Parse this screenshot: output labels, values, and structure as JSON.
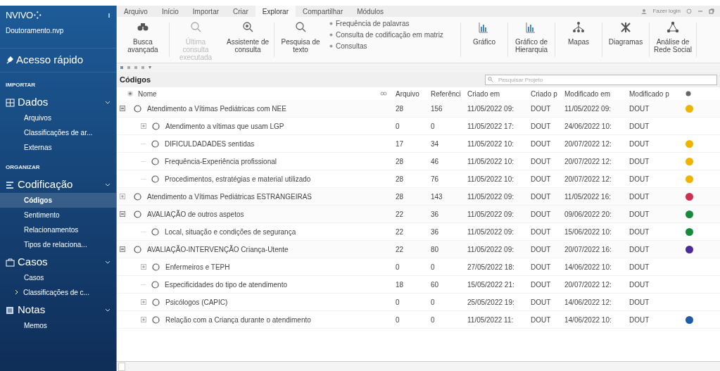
{
  "sidebar": {
    "logo": "NVIVO",
    "logo_mark": "⁘",
    "project": "Doutoramento.nvp",
    "quick_access": "Acesso rápido",
    "sections": [
      {
        "heading": "IMPORTAR",
        "groups": [
          {
            "kind": "grid",
            "label": "Dados",
            "expanded": true,
            "items": [
              {
                "label": "Arquivos",
                "selected": false
              },
              {
                "label": "Classificações de ar...",
                "selected": false
              },
              {
                "label": "Externas",
                "selected": false
              }
            ]
          }
        ]
      },
      {
        "heading": "ORGANIZAR",
        "groups": [
          {
            "kind": "lines",
            "label": "Codificação",
            "expanded": true,
            "items": [
              {
                "label": "Códigos",
                "selected": true
              },
              {
                "label": "Sentimento",
                "selected": false
              },
              {
                "label": "Relacionamentos",
                "selected": false
              },
              {
                "label": "Tipos de relaciona...",
                "selected": false
              }
            ]
          },
          {
            "kind": "case",
            "label": "Casos",
            "expanded": true,
            "items": [
              {
                "label": "Casos",
                "selected": false
              },
              {
                "label": "Classificações de c...",
                "selected": false,
                "expandable": true
              }
            ]
          },
          {
            "kind": "notes",
            "label": "Notas",
            "expanded": true,
            "items": [
              {
                "label": "Memos",
                "selected": false
              }
            ]
          }
        ]
      }
    ]
  },
  "tabs": [
    {
      "label": "Arquivo",
      "selected": false
    },
    {
      "label": "Início",
      "selected": false
    },
    {
      "label": "Importar",
      "selected": false
    },
    {
      "label": "Criar",
      "selected": false
    },
    {
      "label": "Explorar",
      "selected": true
    },
    {
      "label": "Compartilhar",
      "selected": false
    },
    {
      "label": "Módulos",
      "selected": false
    }
  ],
  "login": "Fazer login",
  "ribbon": {
    "large_left": [
      {
        "kind": "binoculars",
        "label": "Busca avançada",
        "disabled": false
      },
      {
        "kind": "query",
        "label": "Última consulta executada",
        "disabled": true
      },
      {
        "kind": "wizard",
        "label": "Assistente de consulta",
        "disabled": false
      },
      {
        "kind": "search",
        "label": "Pesquisa de texto",
        "disabled": false
      }
    ],
    "small": [
      "Frequência de palavras",
      "Consulta de codificação em matriz",
      "Consultas"
    ],
    "large_right": [
      {
        "kind": "chart",
        "label": "Gráfico"
      },
      {
        "kind": "chart",
        "label": "Gráfico de Hierarquia"
      },
      {
        "kind": "map",
        "label": "Mapas"
      },
      {
        "kind": "diagram",
        "label": "Diagramas"
      },
      {
        "kind": "network",
        "label": "Análise de Rede Social"
      }
    ]
  },
  "panel": {
    "title": "Códigos",
    "search": {
      "placeholder": "Pesquisar Projeto"
    }
  },
  "table": {
    "columns": [
      "Nome",
      "Arquivo",
      "Referênci",
      "Criado em",
      "Criado p",
      "Modificado em",
      "Modificado p"
    ],
    "rows": [
      {
        "name": "Atendimento a Vítimas Pediátricas com NEE",
        "files": "28",
        "refs": "156",
        "created": "11/05/2022 09:",
        "created_by": "DOUT",
        "modified": "11/05/2022 09:",
        "modified_by": "DOUT",
        "color": "#f0b400",
        "expanded": true,
        "children": [
          {
            "name": "Atendimento a vítimas que usam LGP",
            "files": "0",
            "refs": "0",
            "created": "11/05/2022 17:",
            "created_by": "DOUT",
            "modified": "24/06/2022 10:",
            "modified_by": "DOUT",
            "expanded": false
          },
          {
            "name": "DIFICULDADADES sentidas",
            "files": "17",
            "refs": "34",
            "created": "11/05/2022 10:",
            "created_by": "DOUT",
            "modified": "20/07/2022 12:",
            "modified_by": "DOUT",
            "color": "#f0b400"
          },
          {
            "name": "Frequência-Experiência profissional",
            "files": "28",
            "refs": "46",
            "created": "11/05/2022 10:",
            "created_by": "DOUT",
            "modified": "20/07/2022 12:",
            "modified_by": "DOUT",
            "color": "#f0b400"
          },
          {
            "name": "Procedimentos, estratégias e material utilizado",
            "files": "28",
            "refs": "76",
            "created": "11/05/2022 10:",
            "created_by": "DOUT",
            "modified": "20/07/2022 12:",
            "modified_by": "DOUT",
            "color": "#f0b400"
          }
        ]
      },
      {
        "name": "Atendimento a Vítimas Pediátricas ESTRANGEIRAS",
        "files": "28",
        "refs": "143",
        "created": "11/05/2022 09:",
        "created_by": "DOUT",
        "modified": "11/05/2022 16:",
        "modified_by": "DOUT",
        "color": "#d0304f",
        "expanded": false
      },
      {
        "name": "AVALIAÇÃO de outros aspetos",
        "files": "22",
        "refs": "36",
        "created": "11/05/2022 09:",
        "created_by": "DOUT",
        "modified": "09/06/2022 20:",
        "modified_by": "DOUT",
        "color": "#178a3c",
        "expanded": true,
        "children": [
          {
            "name": "Local, situação e condições de segurança",
            "files": "22",
            "refs": "36",
            "created": "11/05/2022 09:",
            "created_by": "DOUT",
            "modified": "15/06/2022 10:",
            "modified_by": "DOUT",
            "color": "#178a3c"
          }
        ]
      },
      {
        "name": "AVALIAÇÃO-INTERVENÇÃO Criança-Utente",
        "files": "22",
        "refs": "80",
        "created": "11/05/2022 09:",
        "created_by": "DOUT",
        "modified": "20/07/2022 16:",
        "modified_by": "DOUT",
        "color": "#4b2a9c",
        "expanded": true,
        "children": [
          {
            "name": "Enfermeiros e TEPH",
            "files": "0",
            "refs": "0",
            "created": "27/05/2022 18:",
            "created_by": "DOUT",
            "modified": "14/06/2022 10:",
            "modified_by": "DOUT",
            "expanded": false
          },
          {
            "name": "Especificidades do tipo de atendimento",
            "files": "18",
            "refs": "60",
            "created": "15/05/2022 21:",
            "created_by": "DOUT",
            "modified": "20/07/2022 12:",
            "modified_by": "DOUT"
          },
          {
            "name": "Psicólogos (CAPIC)",
            "files": "0",
            "refs": "0",
            "created": "25/05/2022 19:",
            "created_by": "DOUT",
            "modified": "14/06/2022 12:",
            "modified_by": "DOUT",
            "expanded": false
          },
          {
            "name": "Relação com a Criança durante o atendimento",
            "files": "0",
            "refs": "0",
            "created": "11/05/2022 11:",
            "created_by": "DOUT",
            "modified": "14/06/2022 10:",
            "modified_by": "DOUT",
            "color": "#1f5ca8",
            "expanded": false
          }
        ]
      }
    ]
  }
}
